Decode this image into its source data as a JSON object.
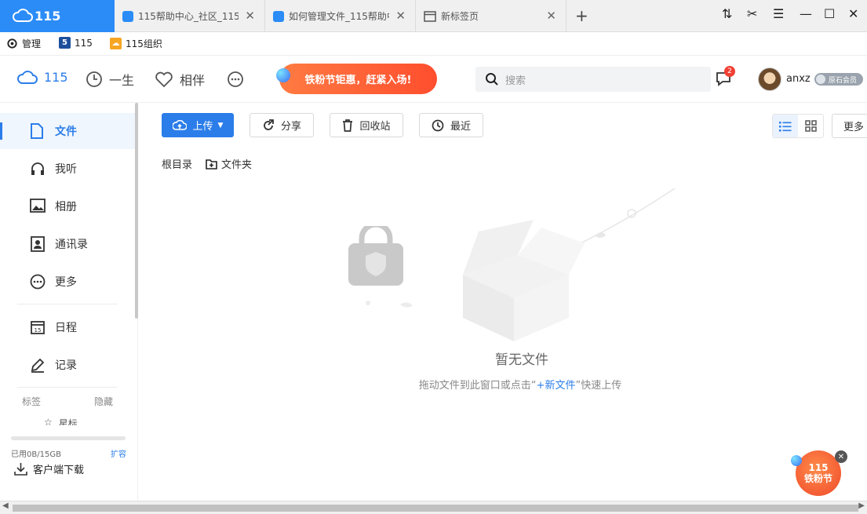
{
  "browser": {
    "brand_label": "115",
    "tabs": [
      {
        "label": "115帮助中心_社区_115"
      },
      {
        "label": "如何管理文件_115帮助中"
      },
      {
        "label": "新标签页"
      }
    ]
  },
  "bookmarks": [
    {
      "label": "管理"
    },
    {
      "label": "115"
    },
    {
      "label": "115组织"
    }
  ],
  "header": {
    "nav": [
      {
        "label": "115",
        "icon": "cloud-icon"
      },
      {
        "label": "一生",
        "icon": "clock-icon"
      },
      {
        "label": "相伴",
        "icon": "heart-icon"
      }
    ],
    "promo_text": "铁粉节钜惠，赶紧入场!",
    "search_placeholder": "搜索",
    "message_count": "2",
    "username": "anxz",
    "member_badge": "原石会员"
  },
  "sidebar": {
    "items": [
      {
        "label": "文件",
        "icon": "file-icon"
      },
      {
        "label": "我听",
        "icon": "headphones-icon"
      },
      {
        "label": "相册",
        "icon": "image-icon"
      },
      {
        "label": "通讯录",
        "icon": "contacts-icon"
      },
      {
        "label": "更多",
        "icon": "more-icon"
      },
      {
        "label": "日程",
        "icon": "calendar-icon"
      },
      {
        "label": "记录",
        "icon": "edit-icon"
      }
    ],
    "calendar_day": "15",
    "tags_label": "标签",
    "hide_label": "隐藏",
    "star_label": "星标",
    "storage_used": "已用0B/15GB",
    "expand_label": "扩容",
    "client_download": "客户端下载"
  },
  "toolbar": {
    "upload": "上传",
    "share": "分享",
    "recycle": "回收站",
    "recent": "最近",
    "more": "更多"
  },
  "breadcrumb": {
    "root": "根目录",
    "folder": "文件夹"
  },
  "empty": {
    "title": "暂无文件",
    "hint_before": "拖动文件到此窗口或点击“",
    "hint_link": "+新文件",
    "hint_after": "”快速上传"
  },
  "floating": {
    "line1": "115",
    "line2": "铁粉节"
  },
  "colors": {
    "brand": "#2b8cf7",
    "accent": "#2b7de9",
    "promo": "#ff5a30"
  }
}
